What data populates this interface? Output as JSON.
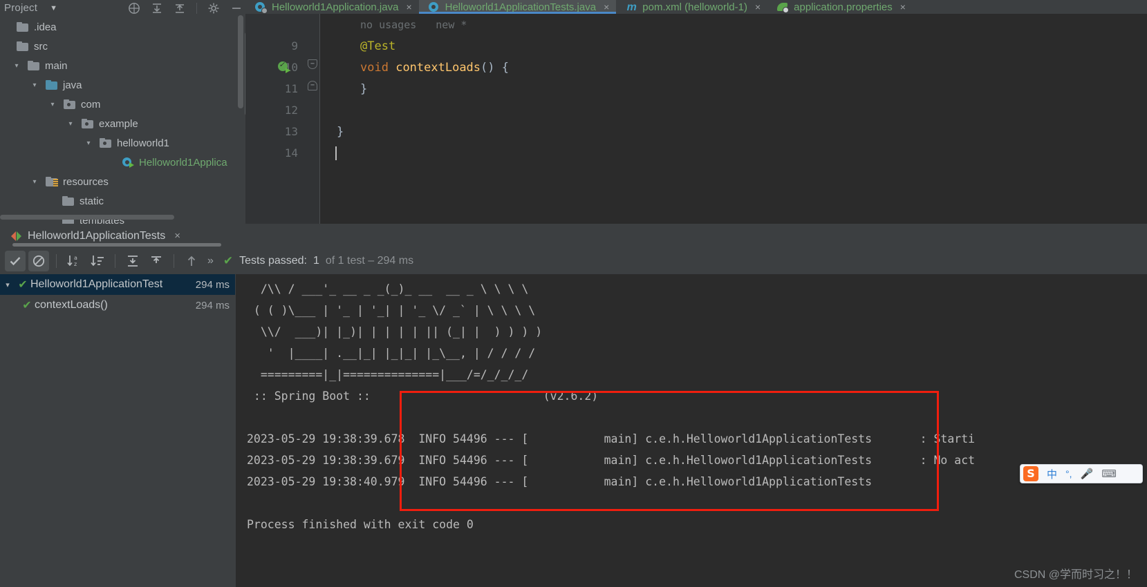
{
  "project_panel": {
    "title": "Project",
    "chevron_icon": "chevron-down-icon",
    "toolbar_icons": [
      "help-icon",
      "expand-all-icon",
      "collapse-all-icon",
      "settings-gear-icon",
      "hide-icon"
    ],
    "tree": [
      {
        "label": ".idea",
        "icon": "folder-icon",
        "arrow": "",
        "indent": 0,
        "color": "normal"
      },
      {
        "label": "src",
        "icon": "folder-icon",
        "arrow": "",
        "indent": 0,
        "color": "normal"
      },
      {
        "label": "main",
        "icon": "folder-icon",
        "arrow": "v",
        "indent": 1,
        "color": "normal"
      },
      {
        "label": "java",
        "icon": "source-root-icon",
        "arrow": "v",
        "indent": 2,
        "color": "normal"
      },
      {
        "label": "com",
        "icon": "package-icon",
        "arrow": "v",
        "indent": 3,
        "color": "normal"
      },
      {
        "label": "example",
        "icon": "package-icon",
        "arrow": "v",
        "indent": 4,
        "color": "normal"
      },
      {
        "label": "helloworld1",
        "icon": "package-icon",
        "arrow": "v",
        "indent": 5,
        "color": "normal"
      },
      {
        "label": "Helloworld1Applica",
        "icon": "java-class-run-icon",
        "arrow": "",
        "indent": 6,
        "color": "green"
      },
      {
        "label": "resources",
        "icon": "resources-root-icon",
        "arrow": "v",
        "indent": 2,
        "color": "normal"
      },
      {
        "label": "static",
        "icon": "folder-icon",
        "arrow": "",
        "indent": 3,
        "color": "normal"
      },
      {
        "label": "templates",
        "icon": "folder-icon",
        "arrow": "",
        "indent": 3,
        "color": "normal"
      }
    ]
  },
  "editor": {
    "tabs": [
      {
        "label": "Helloworld1Application.java",
        "icon": "spring-class-icon",
        "active": false,
        "close": "×"
      },
      {
        "label": "Helloworld1ApplicationTests.java",
        "icon": "java-class-icon",
        "active": true,
        "close": "×"
      },
      {
        "label": "pom.xml (helloworld-1)",
        "icon": "maven-icon",
        "active": false,
        "close": "×"
      },
      {
        "label": "application.properties",
        "icon": "spring-leaf-icon",
        "active": false,
        "close": "×"
      }
    ],
    "hint_usages": "no usages",
    "hint_new": "new *",
    "lines": [
      {
        "number": "9",
        "text": "@Test",
        "kind": "annotation",
        "gutter_icon": ""
      },
      {
        "number": "10",
        "text": "void contextLoads() {",
        "kind": "method",
        "gutter_icon": "run-test-icon"
      },
      {
        "number": "11",
        "text": "}",
        "kind": "brace",
        "gutter_icon": ""
      },
      {
        "number": "12",
        "text": "",
        "kind": "plain",
        "gutter_icon": ""
      },
      {
        "number": "13",
        "text": "}",
        "kind": "brace-outer",
        "gutter_icon": ""
      },
      {
        "number": "14",
        "text": "",
        "kind": "caret",
        "gutter_icon": ""
      }
    ],
    "code_tokens": {
      "kw_void": "void",
      "method_name": "contextLoads",
      "parens": "() {"
    }
  },
  "run_panel": {
    "tab_label": "Helloworld1ApplicationTests",
    "tab_icon": "run-config-icon",
    "tab_close": "×",
    "toolbar": [
      {
        "name": "show-passed-toggle",
        "icon": "check-icon",
        "active": true
      },
      {
        "name": "show-ignored-toggle",
        "icon": "no-entry-icon",
        "active": true
      },
      {
        "name": "sort-alphabetically",
        "icon": "sort-az-icon",
        "active": false
      },
      {
        "name": "sort-by-duration",
        "icon": "sort-duration-icon",
        "active": false
      },
      {
        "name": "expand-all",
        "icon": "expand-all-icon",
        "active": false
      },
      {
        "name": "collapse-all",
        "icon": "collapse-all-icon",
        "active": false
      },
      {
        "name": "previous-occurrence",
        "icon": "arrow-up-icon",
        "active": false
      },
      {
        "name": "more-options",
        "icon": "double-chevron-icon",
        "active": false
      }
    ],
    "status": {
      "check_icon": "green-check-icon",
      "prefix": "Tests passed:",
      "count": "1",
      "suffix": "of 1 test – 294 ms"
    },
    "test_tree": [
      {
        "label": "Helloworld1ApplicationTest",
        "time": "294 ms",
        "arrow": "v",
        "selected": true,
        "indent": 0
      },
      {
        "label": "contextLoads()",
        "time": "294 ms",
        "arrow": "",
        "selected": false,
        "indent": 1
      }
    ]
  },
  "console": {
    "banner": [
      "  /\\\\ / ___'_ __ _ _(_)_ __  __ _ \\ \\ \\ \\",
      " ( ( )\\___ | '_ | '_| | '_ \\/ _` | \\ \\ \\ \\",
      "  \\\\/  ___)| |_)| | | | | || (_| |  ) ) ) )",
      "   '  |____| .__|_| |_|_| |_\\__, | / / / /",
      "  =========|_|==============|___/=/_/_/_/"
    ],
    "spring_label": " :: Spring Boot :: ",
    "spring_version": "(v2.6.2)",
    "log_lines": [
      {
        "timestamp": "2023-05-29 19:38:39.678",
        "level": "INFO",
        "pid": "54496",
        "sep": "---",
        "thread": "[           main]",
        "logger": "c.e.h.Helloworld1ApplicationTests",
        "colon": ":",
        "message": "Starti"
      },
      {
        "timestamp": "2023-05-29 19:38:39.679",
        "level": "INFO",
        "pid": "54496",
        "sep": "---",
        "thread": "[           main]",
        "logger": "c.e.h.Helloworld1ApplicationTests",
        "colon": ":",
        "message": "No act"
      },
      {
        "timestamp": "2023-05-29 19:38:40.979",
        "level": "INFO",
        "pid": "54496",
        "sep": "---",
        "thread": "[           main]",
        "logger": "c.e.h.Helloworld1ApplicationTests",
        "colon": ":",
        "message": ""
      }
    ],
    "exit_line": "Process finished with exit code 0"
  },
  "annotation": {
    "highlight_box_color": "#f01e0e"
  },
  "ime_bar": {
    "logo": "S",
    "mode": "中",
    "punct": "°,",
    "mic_icon": "microphone-icon",
    "keyboard_icon": "keyboard-icon"
  },
  "watermark": "CSDN @学而时习之！！"
}
